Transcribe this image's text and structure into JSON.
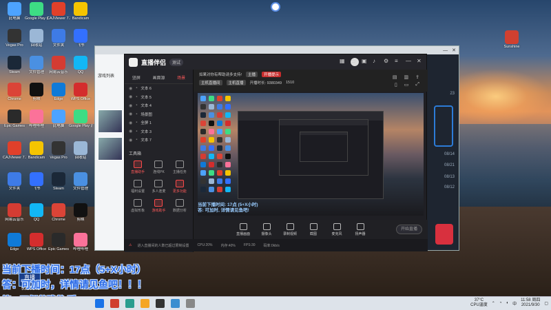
{
  "desktop_icons": [
    {
      "label": "此电脑",
      "color": "#4da3ff"
    },
    {
      "label": "Google Play 游戏",
      "color": "#3ddc84"
    },
    {
      "label": "CAJViewer 7.3",
      "color": "#e0402a"
    },
    {
      "label": "Bandicam",
      "color": "#f5c400"
    },
    {
      "label": "Vegas Pro",
      "color": "#333333"
    },
    {
      "label": "回收站",
      "color": "#9bb7d6"
    },
    {
      "label": "文件夹",
      "color": "#3e7be6"
    },
    {
      "label": "飞书",
      "color": "#3370ff"
    },
    {
      "label": "Steam",
      "color": "#1b2838"
    },
    {
      "label": "文件管理",
      "color": "#4a90e2"
    },
    {
      "label": "网易云音乐",
      "color": "#d43c33"
    },
    {
      "label": "QQ",
      "color": "#12b7f5"
    },
    {
      "label": "Chrome",
      "color": "#db4437"
    },
    {
      "label": "剪映",
      "color": "#111111"
    },
    {
      "label": "Edge",
      "color": "#0f7ad8"
    },
    {
      "label": "WPS Office",
      "color": "#d42d2d"
    },
    {
      "label": "Epic Games",
      "color": "#2a2a2a"
    },
    {
      "label": "哔哩哔哩",
      "color": "#fb7299"
    }
  ],
  "right_desktop_icon": {
    "label": "Sunshine",
    "color": "#d04030"
  },
  "obs_window": {
    "side_title": "游戏列表",
    "right_numbers": [
      "23",
      "08/14",
      "08/21",
      "08/13",
      "08/12"
    ]
  },
  "app": {
    "name": "直播伴侣",
    "version": "测试",
    "tabs": [
      "竖屏",
      "画面源",
      "场景"
    ],
    "active_tab": "场景",
    "layers": [
      "文本 6",
      "文本 5",
      "文本 4",
      "场景图",
      "全屏 1",
      "文本 3",
      "文本 7"
    ],
    "tools_title": "工具箱",
    "tools": [
      {
        "label": "直播助手",
        "red": true
      },
      {
        "label": "连线PK",
        "red": false
      },
      {
        "label": "主播任务",
        "red": false
      },
      {
        "label": "福利设置",
        "red": false
      },
      {
        "label": "多人连麦",
        "red": false
      },
      {
        "label": "更多功能",
        "red": true
      },
      {
        "label": "虚拟形象",
        "red": false
      },
      {
        "label": "游戏助手",
        "red": true
      },
      {
        "label": "数据分析",
        "red": false
      }
    ],
    "status_line1": "如果对你有帮助请多支持!",
    "status_tag1": "主播",
    "status_tag2": "开播提示",
    "status_line2_parts": [
      "主机直播间",
      "主机直播",
      "开播时长: 9380349",
      "1510"
    ],
    "preview_line1": "当前下播时间: 17点 (5+X小时)",
    "preview_line2": "答: 可加时, 详情请见鱼吧!",
    "bottom_buttons": [
      "直播画面",
      "摄像头",
      "录制视频",
      "截图",
      "麦克风",
      "扬声器"
    ],
    "start_button": "开始直播",
    "footer_warning": "进入直播间的人数已超过限制设置",
    "footer_stats": [
      "CPU:20%",
      "内存:40%",
      "FPS:30",
      "码率:0kb/s"
    ]
  },
  "overlay": {
    "line1": "当前下播时间：17点（5+X小时）",
    "line2": "答：可加时，详情请见鱼吧！！！",
    "line3": "答：不倒翁残翁 瞬",
    "logo_text": "直播",
    "room_id": "9380349"
  },
  "taskbar": {
    "icons": [
      "#1a73e8",
      "#d04030",
      "#2a9d8f",
      "#f5a623",
      "#333333",
      "#3b8ed0",
      "#888888"
    ],
    "weather_temp": "37°C",
    "weather_desc": "CPU温度",
    "time": "11:58 周四",
    "date": "2021/9/30"
  }
}
